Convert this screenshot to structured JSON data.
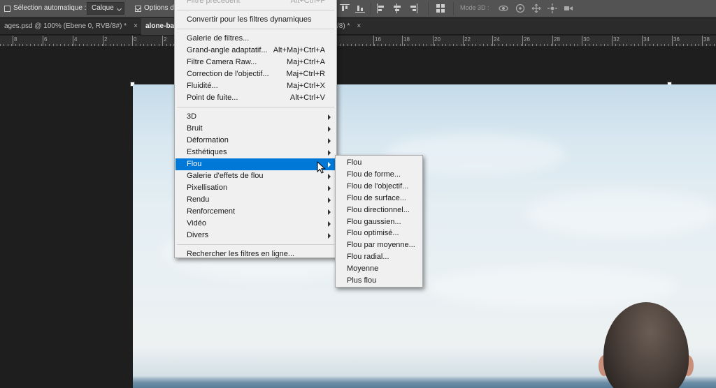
{
  "options_bar": {
    "auto_select_label": "Sélection automatique :",
    "auto_select_checked": false,
    "layer_select_value": "Calque",
    "transform_options_label": "Options de",
    "transform_options_checked": true,
    "mode3d_label": "Mode 3D :"
  },
  "tabs": [
    {
      "label": "ages.psd @ 100% (Ebene 0, RVB/8#) *",
      "close": "×",
      "active": false
    },
    {
      "label": "alone-ba",
      "close": "",
      "active": true
    },
    {
      "label": "/8) *",
      "close": "×",
      "active": false
    }
  ],
  "ruler": {
    "labels": [
      "8",
      "6",
      "4",
      "2",
      "0",
      "2",
      "16",
      "18",
      "20",
      "22",
      "24",
      "26",
      "28",
      "30",
      "32",
      "34",
      "36",
      "38"
    ]
  },
  "filter_menu": {
    "items": [
      {
        "label": "Filtre précédent",
        "shortcut": "Alt+Ctrl+F",
        "disabled": true
      },
      {
        "separator": true
      },
      {
        "label": "Convertir pour les filtres dynamiques",
        "shortcut": ""
      },
      {
        "separator": true
      },
      {
        "label": "Galerie de filtres...",
        "shortcut": ""
      },
      {
        "label": "Grand-angle adaptatif...",
        "shortcut": "Alt+Maj+Ctrl+A"
      },
      {
        "label": "Filtre Camera Raw...",
        "shortcut": "Maj+Ctrl+A"
      },
      {
        "label": "Correction de l'objectif...",
        "shortcut": "Maj+Ctrl+R"
      },
      {
        "label": "Fluidité...",
        "shortcut": "Maj+Ctrl+X"
      },
      {
        "label": "Point de fuite...",
        "shortcut": "Alt+Ctrl+V"
      },
      {
        "separator": true
      },
      {
        "label": "3D",
        "submenu": true
      },
      {
        "label": "Bruit",
        "submenu": true
      },
      {
        "label": "Déformation",
        "submenu": true
      },
      {
        "label": "Esthétiques",
        "submenu": true
      },
      {
        "label": "Flou",
        "submenu": true,
        "highlighted": true
      },
      {
        "label": "Galerie d'effets de flou",
        "submenu": true
      },
      {
        "label": "Pixellisation",
        "submenu": true
      },
      {
        "label": "Rendu",
        "submenu": true
      },
      {
        "label": "Renforcement",
        "submenu": true
      },
      {
        "label": "Vidéo",
        "submenu": true
      },
      {
        "label": "Divers",
        "submenu": true
      },
      {
        "separator": true
      },
      {
        "label": "Rechercher les filtres en ligne...",
        "shortcut": ""
      }
    ]
  },
  "blur_submenu": {
    "items": [
      "Flou",
      "Flou de forme...",
      "Flou de l'objectif...",
      "Flou de surface...",
      "Flou directionnel...",
      "Flou gaussien...",
      "Flou optimisé...",
      "Flou par moyenne...",
      "Flou radial...",
      "Moyenne",
      "Plus flou"
    ]
  },
  "colors": {
    "highlight": "#0078d7",
    "menu_bg": "#f0f0f0",
    "toolbar_bg": "#535353",
    "workspace_bg": "#1e1e1e"
  }
}
